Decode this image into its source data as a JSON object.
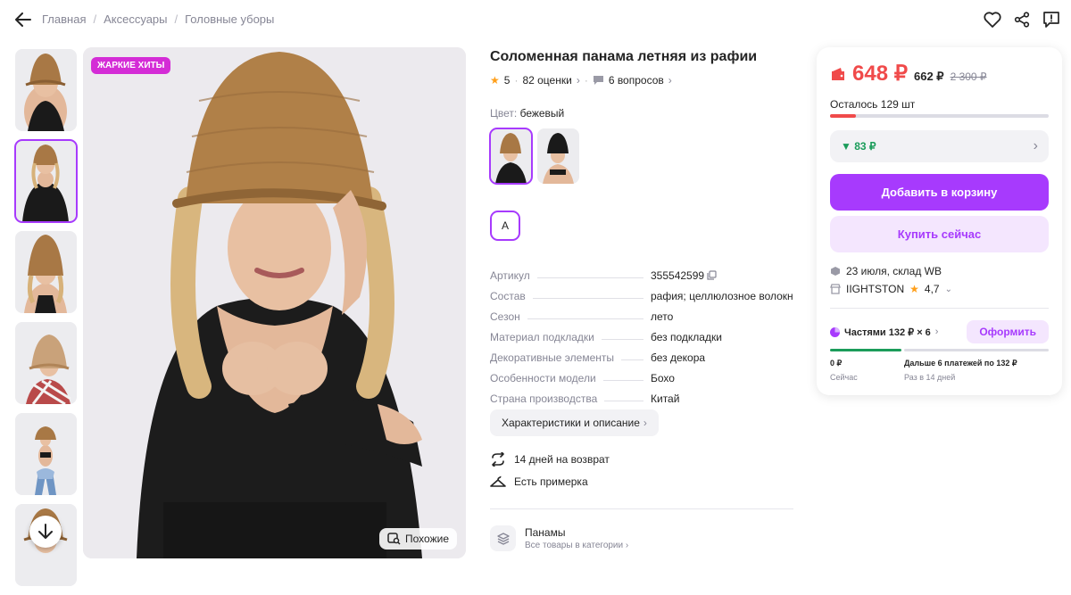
{
  "breadcrumbs": [
    "Главная",
    "Аксессуары",
    "Головные уборы"
  ],
  "product": {
    "badge": "ЖАРКИЕ ХИТЫ",
    "title": "Соломенная панама летняя из рафии",
    "rating": "5",
    "reviews": "82 оценки",
    "questions": "6 вопросов",
    "color_label": "Цвет:",
    "color_value": "бежевый",
    "size": "A",
    "similar": "Похожие"
  },
  "specs": [
    {
      "k": "Артикул",
      "v": "355542599"
    },
    {
      "k": "Состав",
      "v": "рафия; целлюлозное волокно"
    },
    {
      "k": "Сезон",
      "v": "лето"
    },
    {
      "k": "Материал подкладки",
      "v": "без подкладки"
    },
    {
      "k": "Декоративные элементы",
      "v": "без декора"
    },
    {
      "k": "Особенности модели",
      "v": "Бохо"
    },
    {
      "k": "Страна производства",
      "v": "Китай"
    }
  ],
  "details_button": "Характеристики и описание",
  "features": {
    "return": "14 дней на возврат",
    "fitting": "Есть примерка"
  },
  "category": {
    "name": "Панамы",
    "all": "Все товары в категории"
  },
  "buy_card": {
    "price": "648 ₽",
    "price_wallet": "662 ₽",
    "price_old": "2 300 ₽",
    "stock": "Осталось 129 шт",
    "stock_level": 0.12,
    "bonus": "▼ 83 ₽",
    "add_to_cart": "Добавить в корзину",
    "buy_now": "Купить сейчас",
    "delivery": "23 июля, склад WB",
    "seller": "IIGHTSTON",
    "seller_rating": "4,7",
    "installments": "Частями 132 ₽ × 6",
    "installments_button": "Оформить",
    "now_amount": "0 ₽",
    "now_label": "Сейчас",
    "next_amount": "Дальше 6 платежей по 132 ₽",
    "next_label": "Раз в 14 дней"
  },
  "colors": {
    "accent": "#a73afd",
    "price": "#f04a4a",
    "bonus": "#1b9c5a",
    "badge": "#d42cd6"
  }
}
